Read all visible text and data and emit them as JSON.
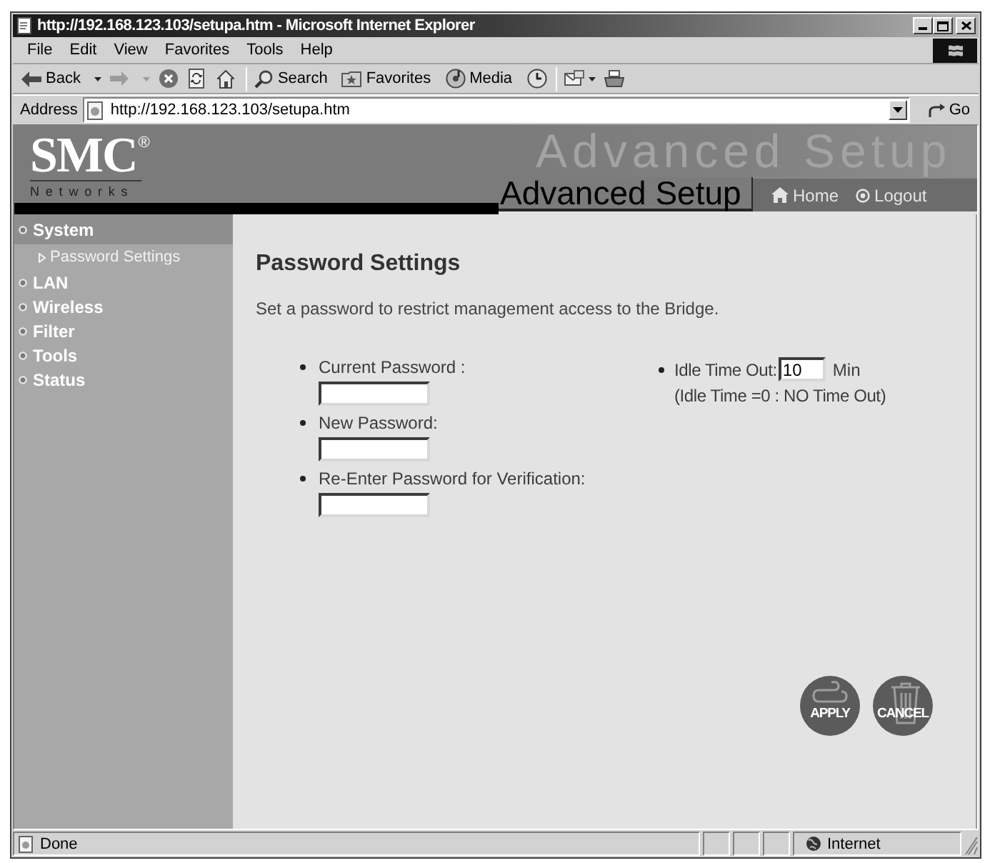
{
  "window": {
    "title": "http://192.168.123.103/setupa.htm - Microsoft Internet Explorer"
  },
  "menu": [
    "File",
    "Edit",
    "View",
    "Favorites",
    "Tools",
    "Help"
  ],
  "toolbar": {
    "back": "Back",
    "search": "Search",
    "favorites": "Favorites",
    "media": "Media"
  },
  "address": {
    "label": "Address",
    "value": "http://192.168.123.103/setupa.htm",
    "go": "Go"
  },
  "header": {
    "logo": "SMC",
    "logo_mark": "®",
    "logo_tagline": "Networks",
    "banner_watermark": "Advanced Setup",
    "banner_title": "Advanced Setup",
    "links": [
      "Home",
      "Logout"
    ]
  },
  "sidebar": {
    "items": [
      {
        "label": "System",
        "selected": true,
        "children": [
          {
            "label": "Password Settings",
            "selected": true
          }
        ]
      },
      {
        "label": "LAN",
        "selected": false
      },
      {
        "label": "Wireless",
        "selected": false
      },
      {
        "label": "Filter",
        "selected": false
      },
      {
        "label": "Tools",
        "selected": false
      },
      {
        "label": "Status",
        "selected": false
      }
    ]
  },
  "content": {
    "title": "Password Settings",
    "description": "Set a password to restrict management access to the Bridge.",
    "password_fields": [
      {
        "label": "Current Password :"
      },
      {
        "label": "New Password:"
      },
      {
        "label": "Re-Enter Password for Verification:"
      }
    ],
    "idle_timeout": {
      "label": "Idle Time Out:",
      "value": "10",
      "unit": "Min",
      "note": "(Idle Time =0 : NO Time Out)"
    },
    "buttons": [
      {
        "kind": "apply",
        "label": "APPLY"
      },
      {
        "kind": "cancel",
        "label": "CANCEL"
      }
    ]
  },
  "status_bar": {
    "text": "Done",
    "zone": "Internet"
  }
}
